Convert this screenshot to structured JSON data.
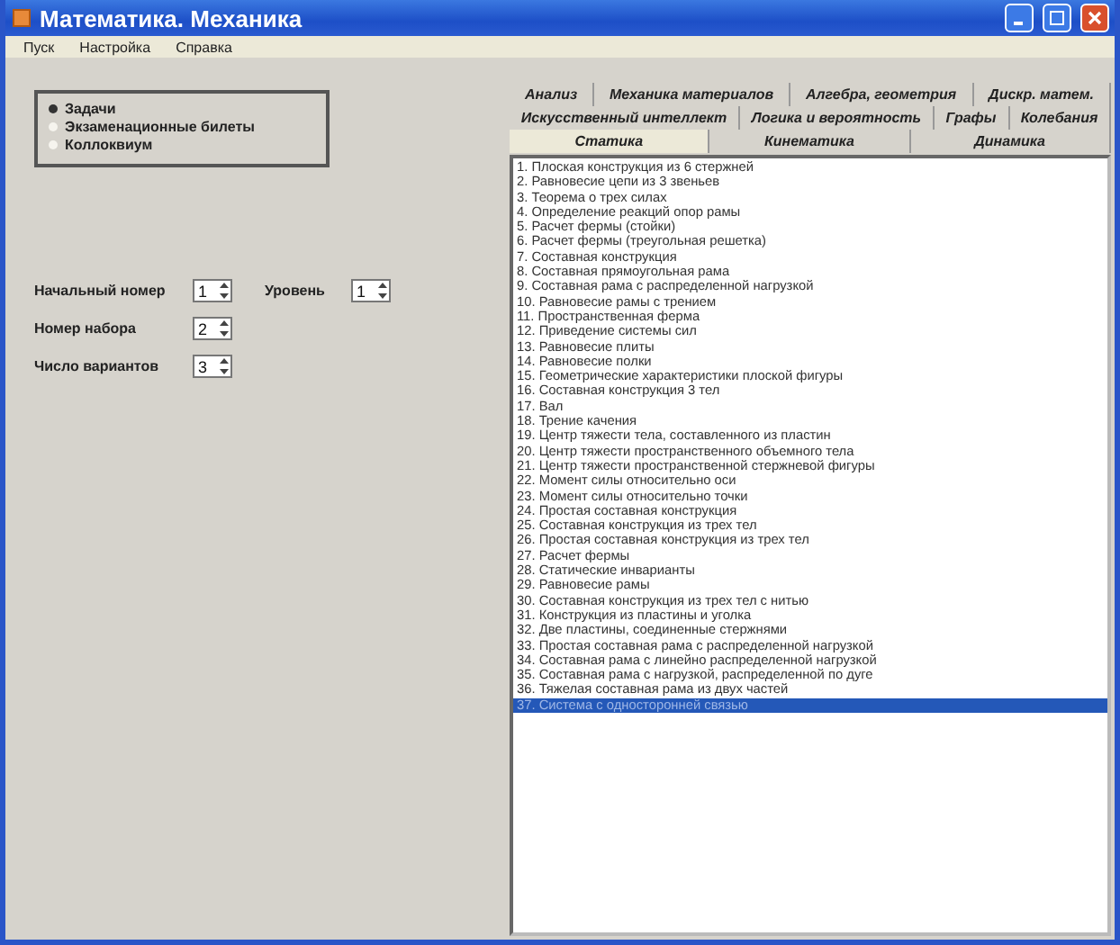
{
  "window": {
    "title": "Математика. Механика"
  },
  "menu": [
    "Пуск",
    "Настройка",
    "Справка"
  ],
  "mode_options": [
    {
      "label": "Задачи",
      "selected": true
    },
    {
      "label": "Экзаменационные билеты",
      "selected": false
    },
    {
      "label": "Коллоквиум",
      "selected": false
    }
  ],
  "fields": [
    {
      "label": "Начальный номер",
      "value": "1"
    },
    {
      "label": "Уровень",
      "value": "1"
    },
    {
      "label": "Номер набора",
      "value": "2"
    },
    {
      "label": "Число вариантов",
      "value": "3"
    }
  ],
  "tab_rows": [
    [
      {
        "label": "Анализ",
        "selected": false
      },
      {
        "label": "Механика материалов",
        "selected": false
      },
      {
        "label": "Алгебра, геометрия",
        "selected": false
      },
      {
        "label": "Дискр. матем.",
        "selected": false
      }
    ],
    [
      {
        "label": "Искусственный интеллект",
        "selected": false
      },
      {
        "label": "Логика и вероятность",
        "selected": false
      },
      {
        "label": "Графы",
        "selected": false
      },
      {
        "label": "Колебания",
        "selected": false
      }
    ],
    [
      {
        "label": "Статика",
        "selected": true
      },
      {
        "label": "Кинематика",
        "selected": false
      },
      {
        "label": "Динамика",
        "selected": false
      }
    ]
  ],
  "problems": [
    {
      "label": "1. Плоская конструкция из 6 стержней",
      "selected": false
    },
    {
      "label": "2. Равновесие цепи из 3 звеньев",
      "selected": false
    },
    {
      "label": "3. Теорема о трех силах",
      "selected": false
    },
    {
      "label": "4. Определение реакций опор рамы",
      "selected": false
    },
    {
      "label": "5. Расчет фермы (стойки)",
      "selected": false
    },
    {
      "label": "6. Расчет фермы (треугольная решетка)",
      "selected": false
    },
    {
      "label": "7. Составная конструкция",
      "selected": false
    },
    {
      "label": "8. Составная прямоугольная рама",
      "selected": false
    },
    {
      "label": "9. Составная рама с распределенной нагрузкой",
      "selected": false
    },
    {
      "label": "10. Равновесие рамы с трением",
      "selected": false
    },
    {
      "label": "11. Пространственная ферма",
      "selected": false
    },
    {
      "label": "12. Приведение системы сил",
      "selected": false
    },
    {
      "label": "13. Равновесие плиты",
      "selected": false
    },
    {
      "label": "14. Равновесие полки",
      "selected": false
    },
    {
      "label": "15. Геометрические характеристики плоской фигуры",
      "selected": false
    },
    {
      "label": "16. Составная конструкция 3 тел",
      "selected": false
    },
    {
      "label": "17. Вал",
      "selected": false
    },
    {
      "label": "18. Трение качения",
      "selected": false
    },
    {
      "label": "19. Центр тяжести тела, составленного из пластин",
      "selected": false
    },
    {
      "label": "20. Центр тяжести пространственного объемного тела",
      "selected": false
    },
    {
      "label": "21. Центр тяжести пространственной стержневой фигуры",
      "selected": false
    },
    {
      "label": "22. Момент силы относительно оси",
      "selected": false
    },
    {
      "label": "23. Момент силы относительно точки",
      "selected": false
    },
    {
      "label": "24. Простая составная конструкция",
      "selected": false
    },
    {
      "label": "25. Составная конструкция из трех тел",
      "selected": false
    },
    {
      "label": "26. Простая составная конструкция из трех тел",
      "selected": false
    },
    {
      "label": "27. Расчет фермы",
      "selected": false
    },
    {
      "label": "28. Статические инварианты",
      "selected": false
    },
    {
      "label": "29. Равновесие рамы",
      "selected": false
    },
    {
      "label": "30. Составная конструкция из трех тел с нитью",
      "selected": false
    },
    {
      "label": "31. Конструкция из пластины и уголка",
      "selected": false
    },
    {
      "label": "32. Две пластины, соединенные стержнями",
      "selected": false
    },
    {
      "label": "33. Простая составная рама с распределенной нагрузкой",
      "selected": false
    },
    {
      "label": "34. Составная рама с линейно распределенной нагрузкой",
      "selected": false
    },
    {
      "label": "35. Составная рама с нагрузкой, распределенной по дуге",
      "selected": false
    },
    {
      "label": "36. Тяжелая составная рама из двух частей",
      "selected": false
    },
    {
      "label": "37. Система с односторонней связью",
      "selected": true
    }
  ]
}
